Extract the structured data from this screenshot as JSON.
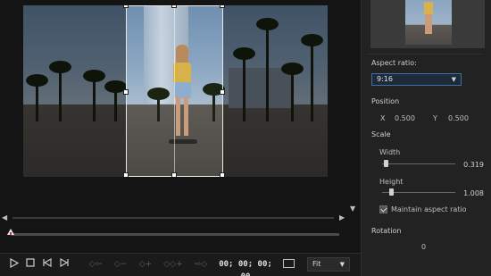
{
  "preview": {
    "timecode": "00; 00; 00; 00",
    "zoom_value": "Fit",
    "playhead_fraction": 0.0,
    "icons": {
      "play": "play-icon",
      "stop": "stop-icon",
      "prev_frame": "previous-frame-icon",
      "next_frame": "next-frame-icon",
      "kf_prev": "previous-keyframe-icon",
      "kf_remove": "remove-keyframe-icon",
      "kf_add": "add-keyframe-icon",
      "kf_duplicate_prev": "duplicate-previous-keyframe-icon",
      "kf_next": "next-keyframe-icon",
      "fullscreen": "monitor-icon"
    }
  },
  "panel": {
    "aspect_ratio_label": "Aspect ratio:",
    "aspect_ratio_value": "9:16",
    "position_label": "Position",
    "x_label": "X",
    "x_value": "0.500",
    "y_label": "Y",
    "y_value": "0.500",
    "scale_label": "Scale",
    "width_label": "Width",
    "width_value": "0.319",
    "width_fraction": 0.02,
    "height_label": "Height",
    "height_value": "1.008",
    "height_fraction": 0.1,
    "maintain_label": "Maintain aspect ratio",
    "maintain_checked": true,
    "rotation_label": "Rotation",
    "rotation_value": "0"
  },
  "colors": {
    "accent": "#3d6fa8",
    "background": "#1c1c1c",
    "panel": "#222222"
  }
}
